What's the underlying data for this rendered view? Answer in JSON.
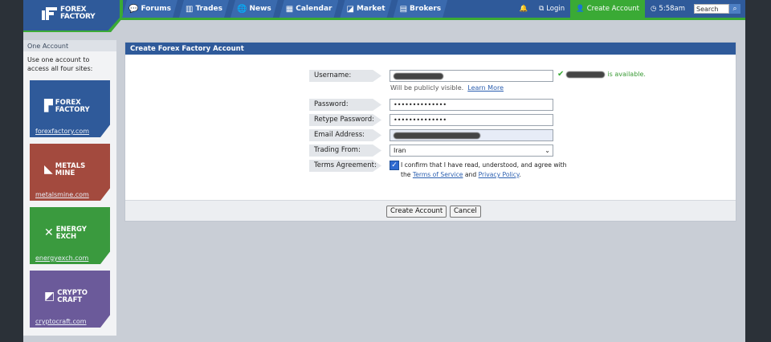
{
  "nav": {
    "logo": [
      "FOREX",
      "FACTORY"
    ],
    "left": [
      {
        "label": "Forums",
        "icon": "forums-icon",
        "glyph": "💬"
      },
      {
        "label": "Trades",
        "icon": "trades-icon",
        "glyph": "▥"
      },
      {
        "label": "News",
        "icon": "news-icon",
        "glyph": "🌐"
      },
      {
        "label": "Calendar",
        "icon": "calendar-icon",
        "glyph": "▦"
      },
      {
        "label": "Market",
        "icon": "market-icon",
        "glyph": "◪"
      },
      {
        "label": "Brokers",
        "icon": "brokers-icon",
        "glyph": "▤"
      }
    ],
    "login": "Login",
    "create_account": "Create Account",
    "time": "5:58am",
    "search_placeholder": "Search"
  },
  "sidebar": {
    "heading": "One Account",
    "description": "Use one account to access all four sites:",
    "sites": [
      {
        "name": [
          "FOREX",
          "FACTORY"
        ],
        "link": "forexfactory.com",
        "color": "#2f5a9a"
      },
      {
        "name": [
          "METALS",
          "MINE"
        ],
        "link": "metalsmine.com",
        "color": "#a34a3e"
      },
      {
        "name": [
          "ENERGY",
          "EXCH"
        ],
        "link": "energyexch.com",
        "color": "#3a9a3e"
      },
      {
        "name": [
          "CRYPTO",
          "CRAFT"
        ],
        "link": "cryptocraft.com",
        "color": "#6b5a9a"
      }
    ]
  },
  "form": {
    "title": "Create Forex Factory Account",
    "username_label": "Username:",
    "username_hint": "Will be publicly visible.",
    "learn_more": "Learn More",
    "available_text": "is available.",
    "password_label": "Password:",
    "password_value": "••••••••••••••",
    "retype_label": "Retype Password:",
    "retype_value": "••••••••••••••",
    "email_label": "Email Address:",
    "trading_label": "Trading From:",
    "trading_value": "Iran",
    "terms_label": "Terms Agreement:",
    "terms_text_1": "I confirm that I have read, understood, and agree with the",
    "terms_of_service": "Terms of Service",
    "terms_and": "and",
    "privacy_policy": "Privacy Policy",
    "terms_end": ".",
    "create_button": "Create Account",
    "cancel_button": "Cancel"
  }
}
